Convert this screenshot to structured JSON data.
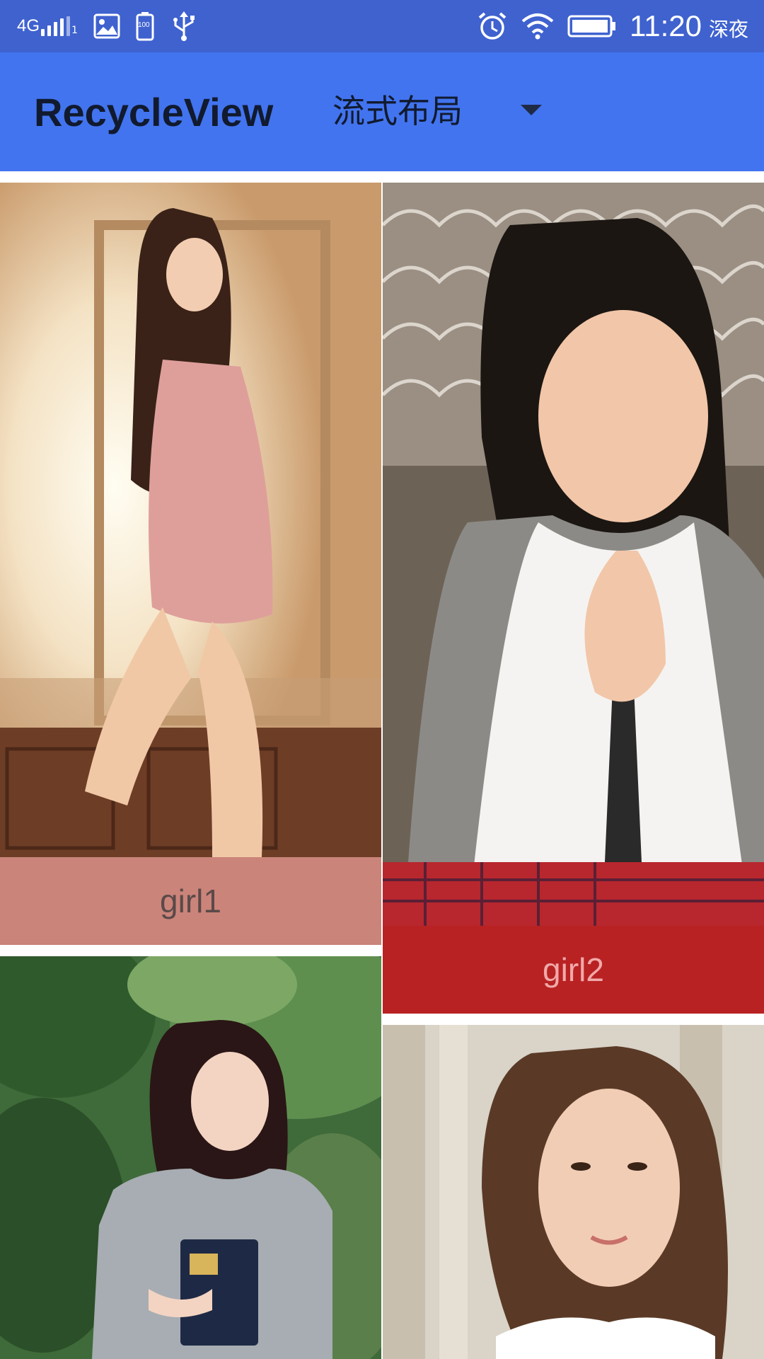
{
  "status_bar": {
    "network": "4G",
    "sim_slot": "1",
    "battery_level": "100",
    "time": "11:20",
    "mode": "深夜",
    "icons": [
      "signal-icon",
      "image-icon",
      "battery-saver-icon",
      "usb-icon",
      "alarm-icon",
      "wifi-icon",
      "battery-icon"
    ]
  },
  "app_bar": {
    "title": "RecycleView",
    "layout_selector": {
      "selected": "流式布局"
    }
  },
  "colors": {
    "status_bar": "#3f62cf",
    "app_bar": "#4274ef",
    "caption_girl1": "#cb847a",
    "caption_girl2": "#b82223"
  },
  "items": [
    {
      "caption": "girl1",
      "caption_color": "#cb847a",
      "text_color": "#5a4a48"
    },
    {
      "caption": "girl2",
      "caption_color": "#b82223",
      "text_color": "#f1a9a9"
    },
    {
      "caption": "",
      "caption_color": "",
      "text_color": ""
    },
    {
      "caption": "",
      "caption_color": "",
      "text_color": ""
    }
  ]
}
